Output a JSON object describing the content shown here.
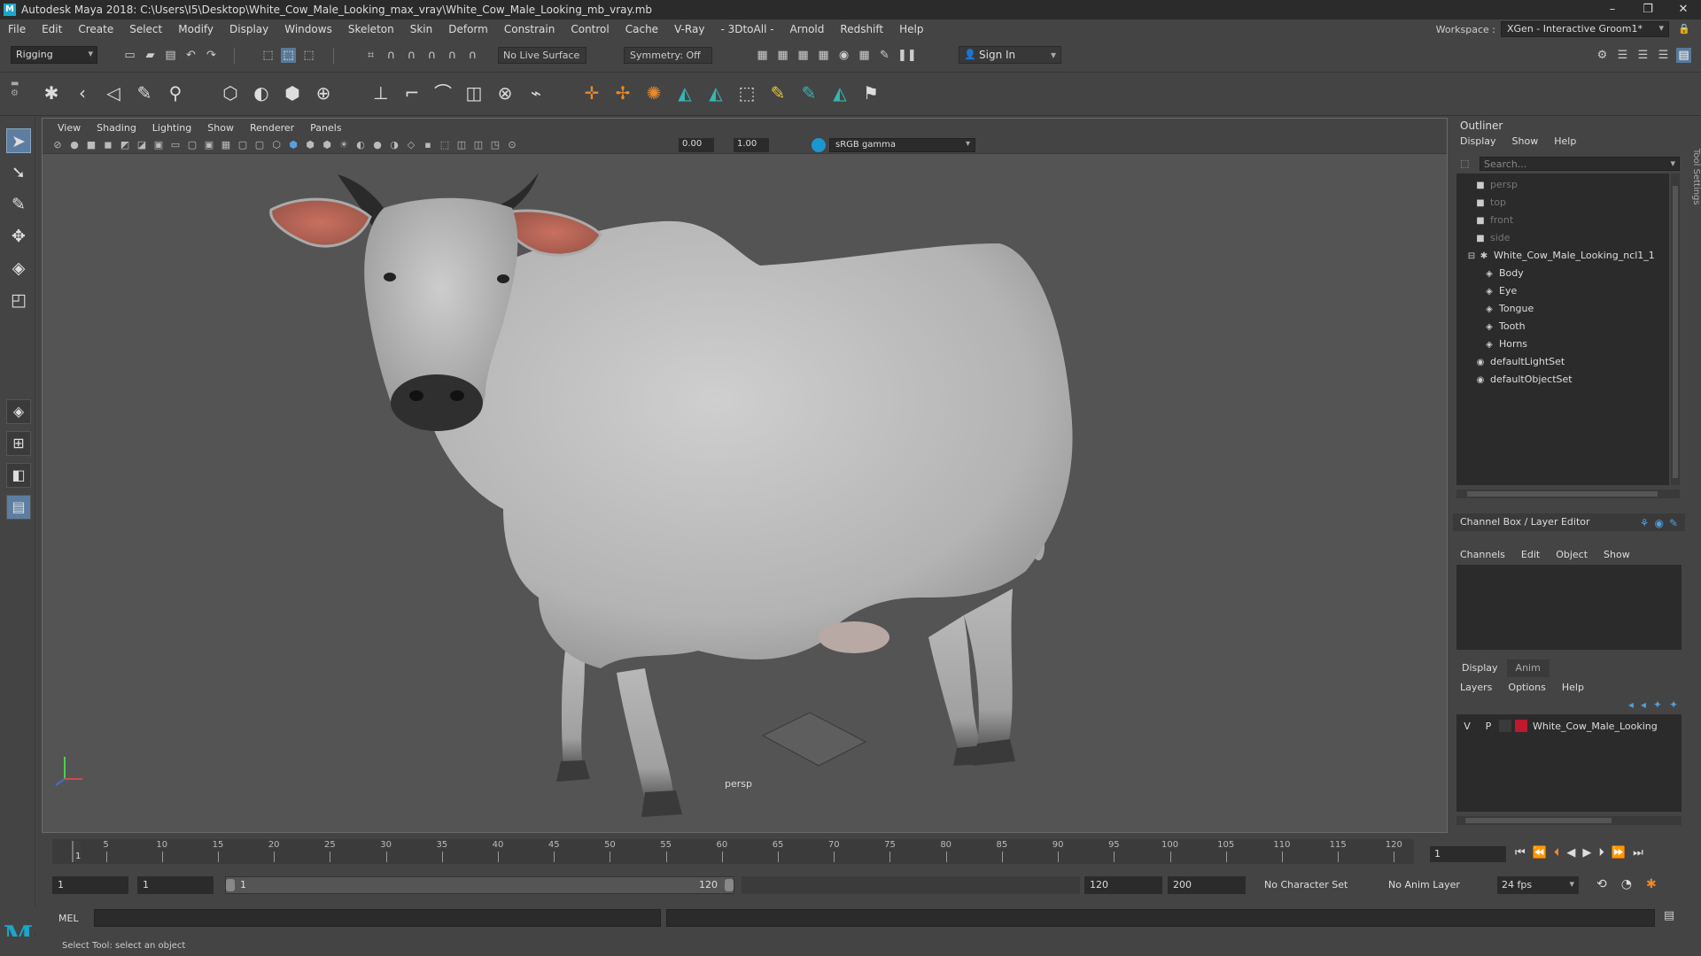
{
  "window": {
    "title": "Autodesk Maya 2018: C:\\Users\\I5\\Desktop\\White_Cow_Male_Looking_max_vray\\White_Cow_Male_Looking_mb_vray.mb",
    "app_icon": "M"
  },
  "menubar": {
    "items": [
      "File",
      "Edit",
      "Create",
      "Select",
      "Modify",
      "Display",
      "Windows",
      "Skeleton",
      "Skin",
      "Deform",
      "Constrain",
      "Control",
      "Cache",
      "V-Ray",
      "- 3DtoAll -",
      "Arnold",
      "Redshift",
      "Help"
    ],
    "workspace_label": "Workspace :",
    "workspace_value": "XGen - Interactive Groom1*"
  },
  "statusline": {
    "mode": "Rigging",
    "live_surface": "No Live Surface",
    "symmetry": "Symmetry: Off",
    "sign_in": "Sign In"
  },
  "viewport": {
    "menus": [
      "View",
      "Shading",
      "Lighting",
      "Show",
      "Renderer",
      "Panels"
    ],
    "exposure": "0.00",
    "gamma": "1.00",
    "color_space": "sRGB gamma",
    "camera": "persp"
  },
  "outliner": {
    "title": "Outliner",
    "menus": [
      "Display",
      "Show",
      "Help"
    ],
    "search_placeholder": "Search...",
    "items": [
      {
        "label": "persp",
        "dim": true,
        "icon": "camera-icon",
        "indent": 2
      },
      {
        "label": "top",
        "dim": true,
        "icon": "camera-icon",
        "indent": 2
      },
      {
        "label": "front",
        "dim": true,
        "icon": "camera-icon",
        "indent": 2
      },
      {
        "label": "side",
        "dim": true,
        "icon": "camera-icon",
        "indent": 2
      },
      {
        "label": "White_Cow_Male_Looking_ncl1_1",
        "dim": false,
        "icon": "transform-icon",
        "indent": 1
      },
      {
        "label": "Body",
        "dim": false,
        "icon": "mesh-icon",
        "indent": 3
      },
      {
        "label": "Eye",
        "dim": false,
        "icon": "mesh-icon",
        "indent": 3
      },
      {
        "label": "Tongue",
        "dim": false,
        "icon": "mesh-icon",
        "indent": 3
      },
      {
        "label": "Tooth",
        "dim": false,
        "icon": "mesh-icon",
        "indent": 3
      },
      {
        "label": "Horns",
        "dim": false,
        "icon": "mesh-icon",
        "indent": 3
      },
      {
        "label": "defaultLightSet",
        "dim": false,
        "icon": "set-icon",
        "indent": 2
      },
      {
        "label": "defaultObjectSet",
        "dim": false,
        "icon": "set-icon",
        "indent": 2
      }
    ]
  },
  "channelbox": {
    "title": "Channel Box / Layer Editor",
    "menus": [
      "Channels",
      "Edit",
      "Object",
      "Show"
    ]
  },
  "layereditor": {
    "tabs": [
      "Display",
      "Anim"
    ],
    "menus": [
      "Layers",
      "Options",
      "Help"
    ],
    "layer": {
      "v": "V",
      "p": "P",
      "name": "White_Cow_Male_Looking",
      "color": "#c0182d"
    }
  },
  "side_tab": "Tool Settings",
  "timeslider": {
    "ticks": [
      5,
      10,
      15,
      20,
      25,
      30,
      35,
      40,
      45,
      50,
      55,
      60,
      65,
      70,
      75,
      80,
      85,
      90,
      95,
      100,
      105,
      110,
      115,
      120
    ],
    "current_marker": "1",
    "current_frame": "1"
  },
  "rangebar": {
    "start_time": "1",
    "playback_start": "1",
    "range_low": "1",
    "range_high": "120",
    "playback_end": "120",
    "end_time": "200",
    "character_set": "No Character Set",
    "anim_layer": "No Anim Layer",
    "fps": "24 fps"
  },
  "cmdline": {
    "label": "MEL",
    "help": "Select Tool: select an object"
  }
}
